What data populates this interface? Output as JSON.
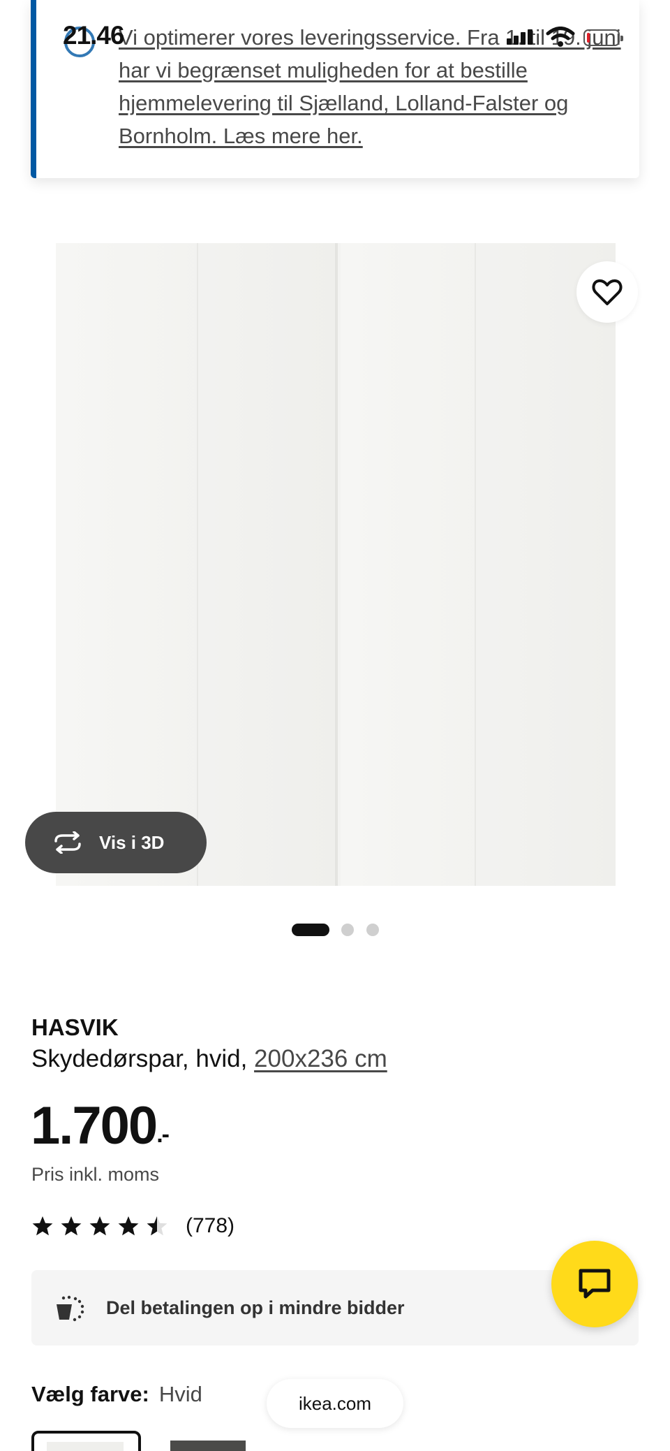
{
  "status_bar": {
    "time": "21.46"
  },
  "notice": {
    "text": "Vi optimerer vores leveringsservice. Fra 1. til 19. juni har vi begrænset muligheden for at bestille hjemmelevering til Sjælland, Lolland-Falster og Bornholm. Læs mere her."
  },
  "gallery": {
    "view_3d_label": "Vis i 3D",
    "image_count": 3,
    "active_index": 0
  },
  "product": {
    "name": "HASVIK",
    "description": "Skydedørspar, hvid, ",
    "size": "200x236 cm",
    "price": "1.700",
    "price_suffix": ".-",
    "price_note": "Pris inkl. moms",
    "rating": 4.5,
    "rating_max": 5,
    "review_count": "(778)"
  },
  "payment": {
    "text": "Del betalingen op i mindre bidder"
  },
  "color": {
    "label": "Vælg farve:",
    "value": "Hvid"
  },
  "browser": {
    "url": "ikea.com"
  },
  "colors": {
    "ikea_blue": "#0058a3",
    "ikea_yellow": "#ffda1a",
    "dark_gray": "#484848"
  }
}
